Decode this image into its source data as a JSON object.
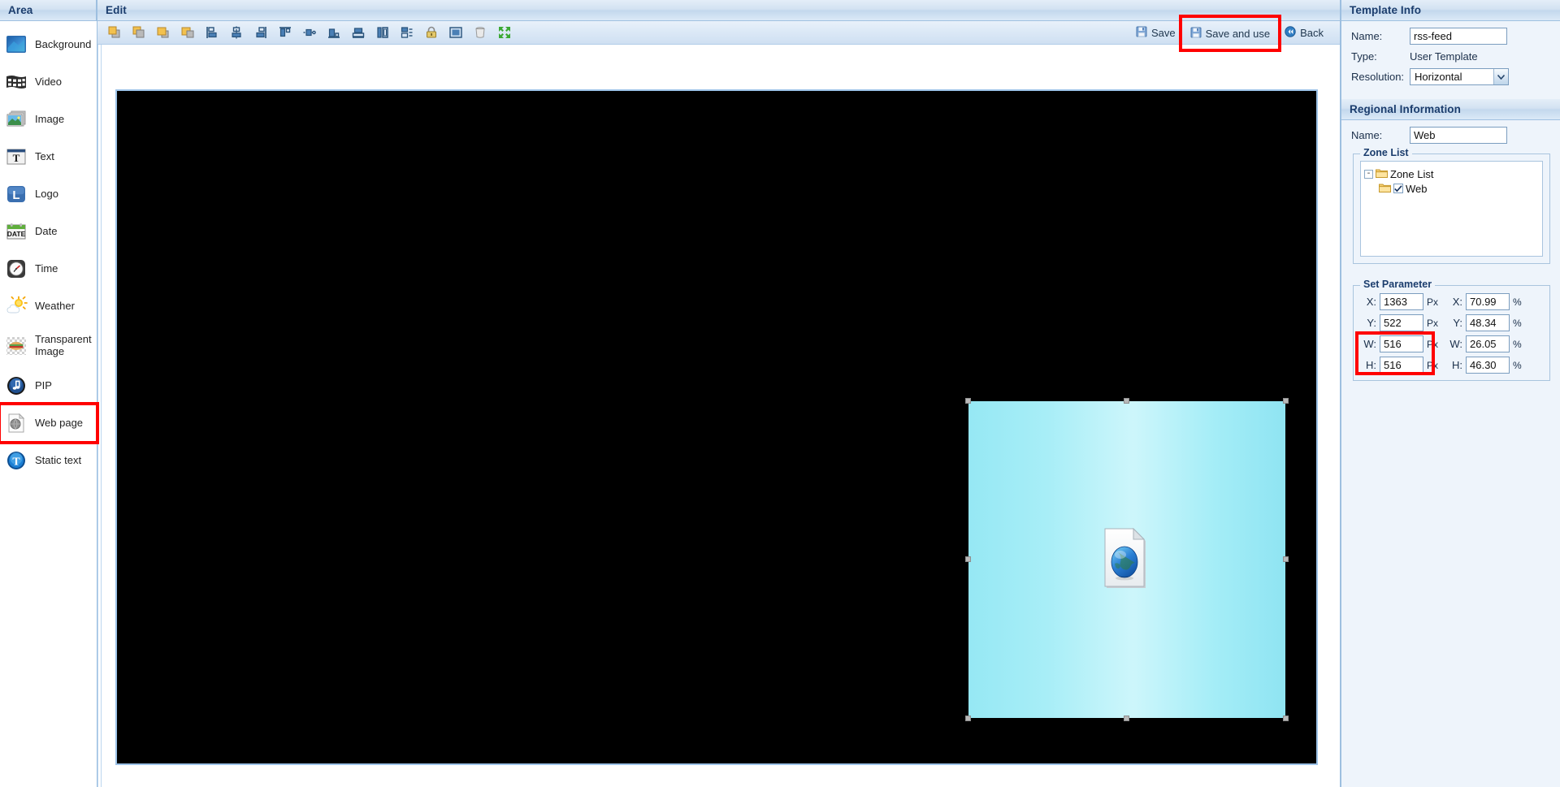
{
  "sidebar": {
    "header": "Area",
    "items": [
      {
        "label": "Background",
        "icon": "background-icon"
      },
      {
        "label": "Video",
        "icon": "video-filmstrip-icon"
      },
      {
        "label": "Image",
        "icon": "image-stack-icon"
      },
      {
        "label": "Text",
        "icon": "text-t-icon"
      },
      {
        "label": "Logo",
        "icon": "logo-l-icon"
      },
      {
        "label": "Date",
        "icon": "date-calendar-icon"
      },
      {
        "label": "Time",
        "icon": "time-clock-icon"
      },
      {
        "label": "Weather",
        "icon": "weather-sun-cloud-icon"
      },
      {
        "label": "Transparent Image",
        "icon": "transparent-image-icon"
      },
      {
        "label": "PIP",
        "icon": "pip-music-note-icon"
      },
      {
        "label": "Web page",
        "icon": "web-page-globe-icon",
        "highlighted": true
      },
      {
        "label": "Static text",
        "icon": "static-text-t-icon"
      }
    ]
  },
  "editor": {
    "header": "Edit",
    "toolbar_icons": [
      "bring-to-front-icon",
      "send-to-back-icon",
      "bring-forward-icon",
      "send-backward-icon",
      "align-left-icon",
      "align-center-horizontal-icon",
      "align-right-icon",
      "align-top-icon",
      "align-middle-vertical-icon",
      "align-bottom-icon",
      "distribute-vertical-icon",
      "same-width-icon",
      "same-height-icon",
      "lock-icon",
      "full-screen-zone-icon",
      "delete-trash-icon",
      "fit-to-screen-icon"
    ],
    "save_label": "Save",
    "save_and_use_label": "Save and use",
    "back_label": "Back",
    "save_icon": "floppy-disk-icon",
    "back_icon": "back-arrows-icon",
    "highlight_color": "#ff0000",
    "canvas_background": "#000000",
    "zone": {
      "name": "Web",
      "icon": "web-page-document-globe-icon",
      "gradient_from": "#8fe4f2",
      "gradient_to": "#cdf6fb"
    }
  },
  "template_info": {
    "header": "Template Info",
    "name_label": "Name:",
    "name_value": "rss-feed",
    "type_label": "Type:",
    "type_value": "User Template",
    "resolution_label": "Resolution:",
    "resolution_value": "Horizontal"
  },
  "regional_information": {
    "header": "Regional Information",
    "name_label": "Name:",
    "name_value": "Web",
    "zone_list_title": "Zone List",
    "tree": {
      "root_label": "Zone List",
      "root_expander": "-",
      "child_label": "Web",
      "child_checked": true
    }
  },
  "set_parameter": {
    "title": "Set Parameter",
    "unit_px": "Px",
    "unit_pct": "%",
    "rows": [
      {
        "label": "X:",
        "px": "1363",
        "pct": "70.99"
      },
      {
        "label": "Y:",
        "px": "522",
        "pct": "48.34"
      },
      {
        "label": "W:",
        "px": "516",
        "pct": "26.05"
      },
      {
        "label": "H:",
        "px": "516",
        "pct": "46.30"
      }
    ]
  }
}
